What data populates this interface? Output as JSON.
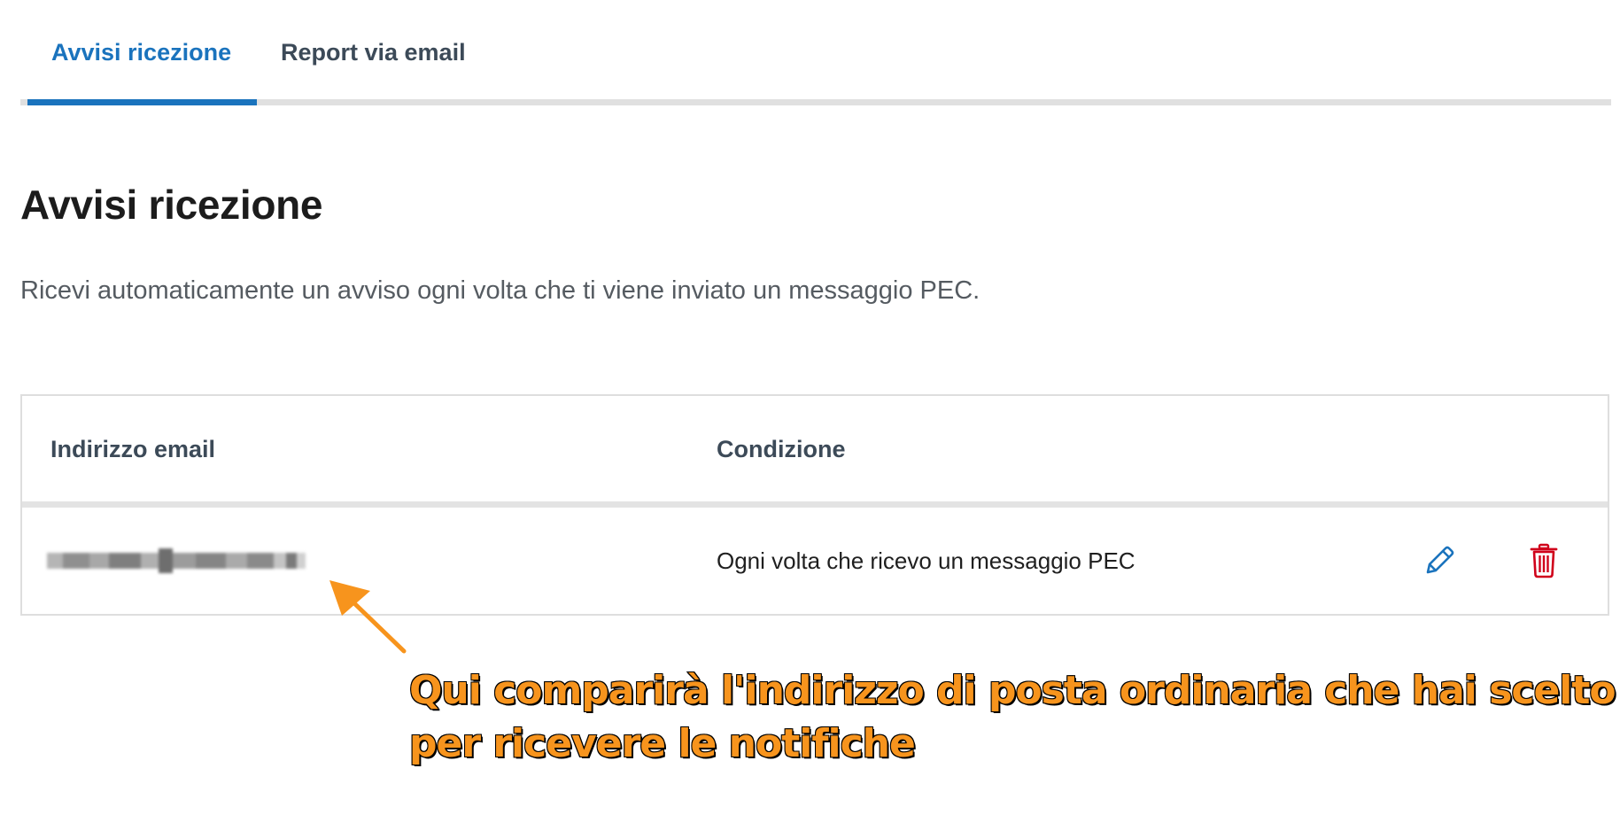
{
  "tabs": [
    {
      "label": "Avvisi ricezione",
      "active": true
    },
    {
      "label": "Report via email",
      "active": false
    }
  ],
  "section": {
    "title": "Avvisi ricezione",
    "description": "Ricevi automaticamente un avviso ogni volta che ti viene inviato un messaggio PEC."
  },
  "table": {
    "headers": {
      "email": "Indirizzo email",
      "condition": "Condizione"
    },
    "rows": [
      {
        "email": "",
        "condition": "Ogni volta che ricevo un messaggio PEC",
        "actions": [
          "pencil-icon",
          "trash-icon"
        ]
      }
    ]
  },
  "annotation": {
    "line1": "Qui comparirà l'indirizzo di posta ordinaria che hai scelto",
    "line2": "per ricevere le notifiche"
  },
  "colors": {
    "accent": "#1a73bd",
    "danger": "#d0021b",
    "annotation": "#f7941d"
  }
}
